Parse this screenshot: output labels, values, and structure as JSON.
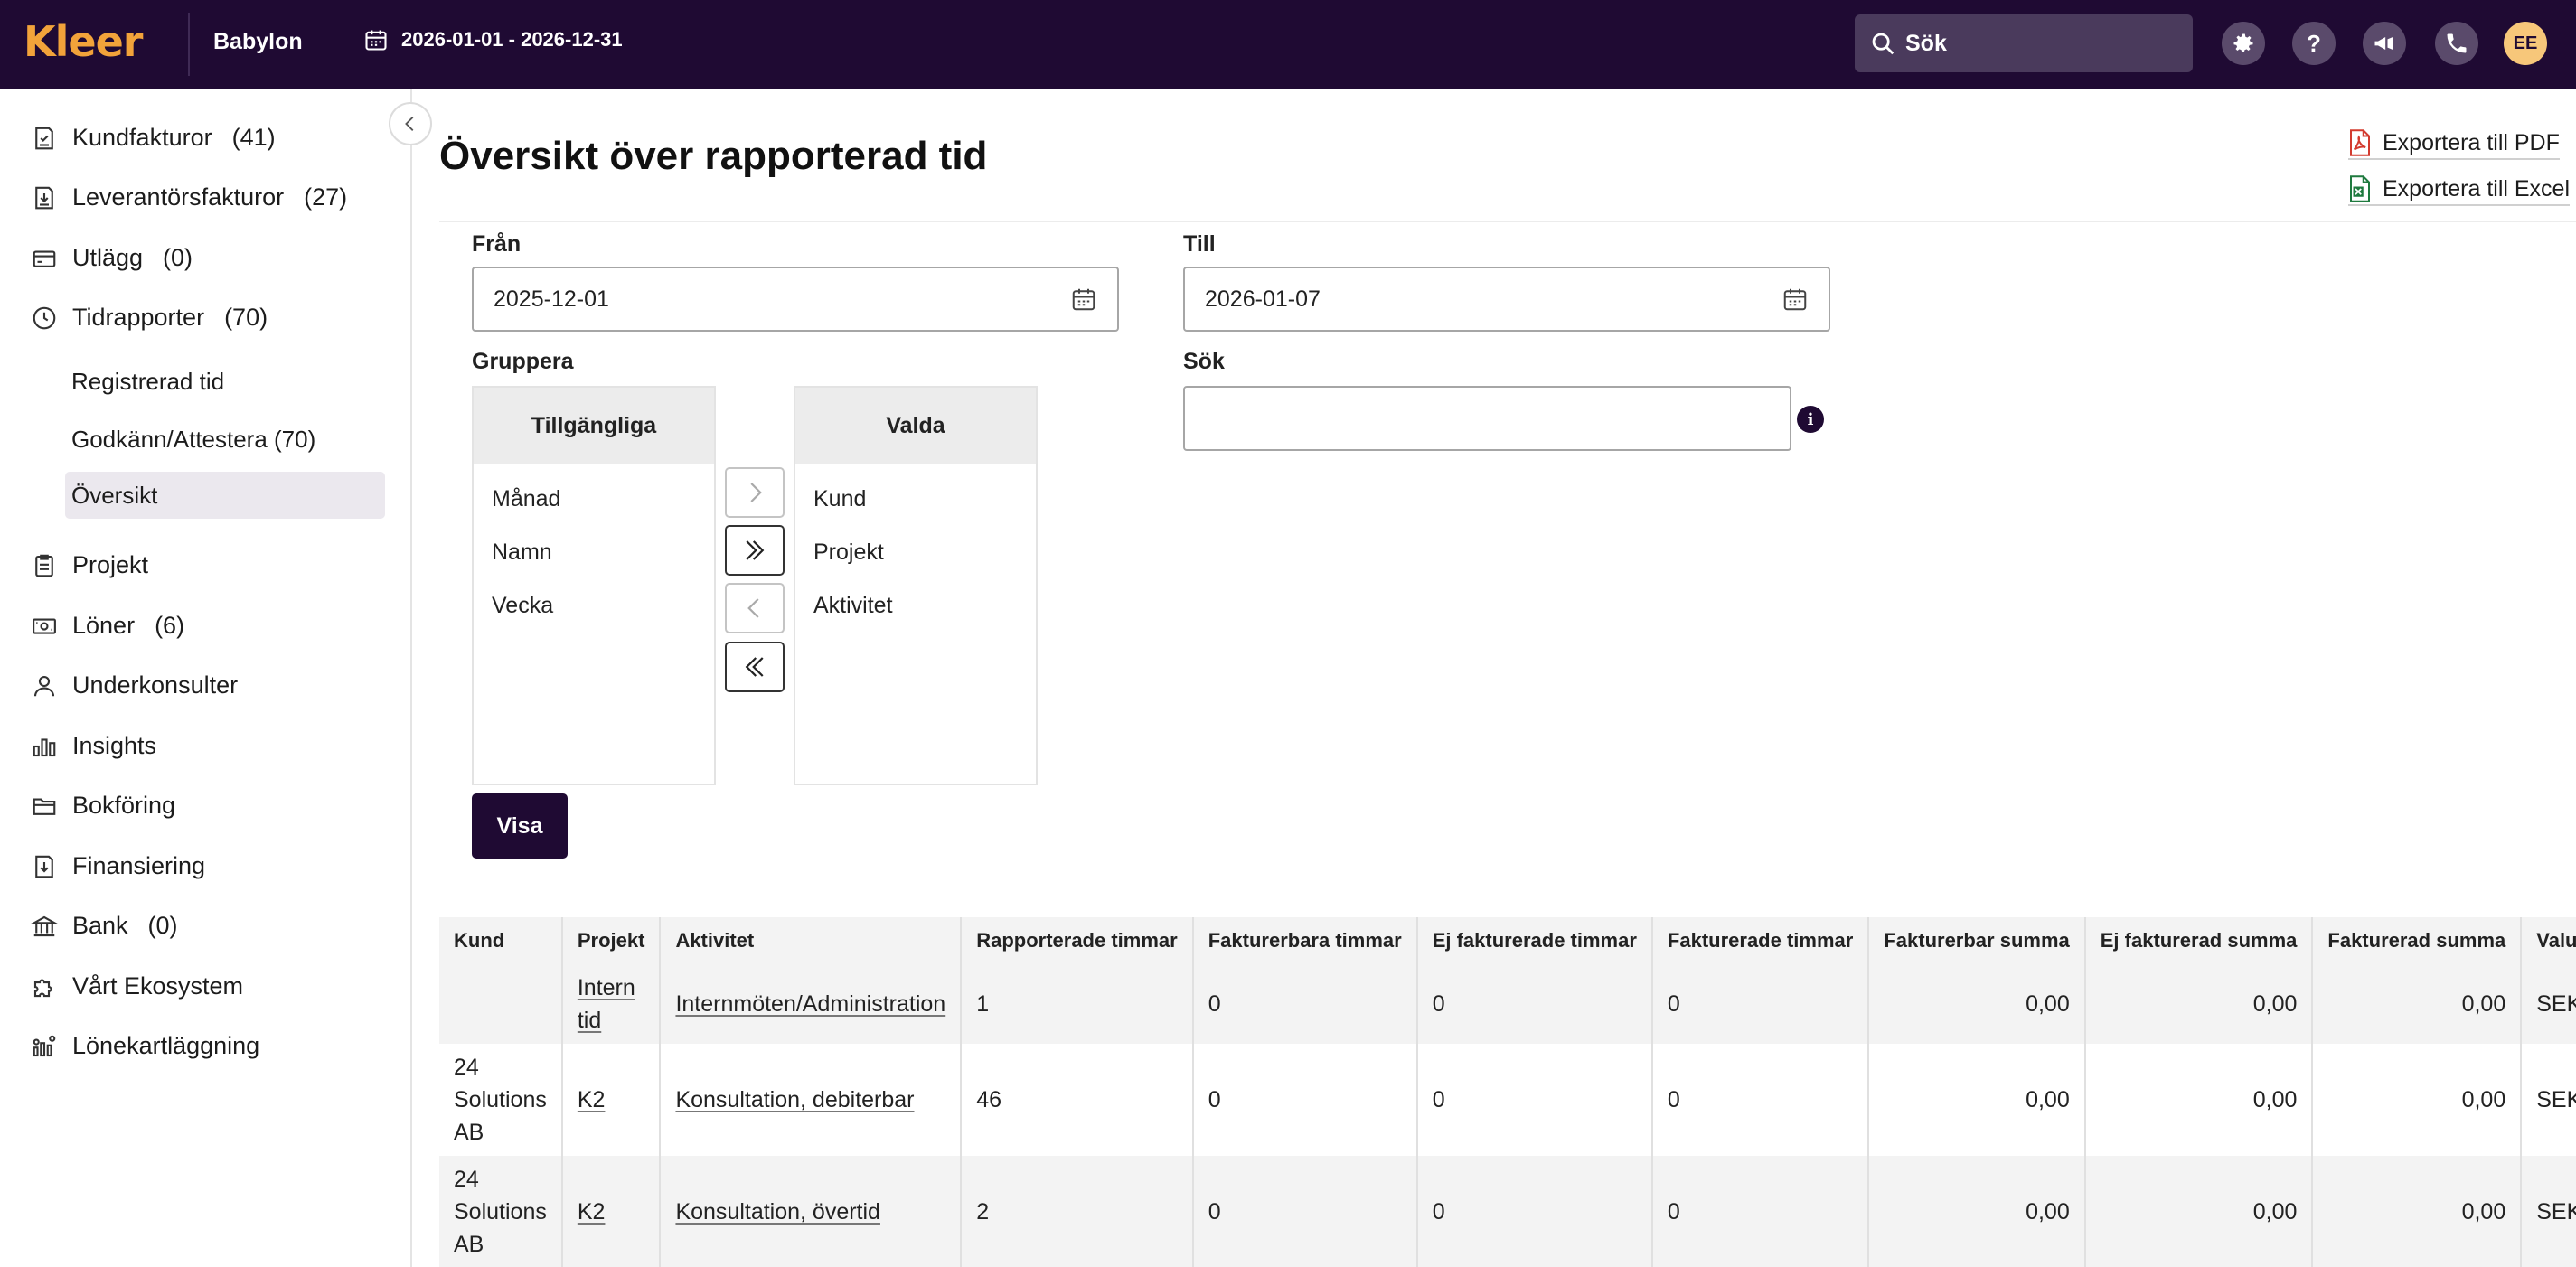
{
  "topbar": {
    "logo": "Kleer",
    "company": "Babylon",
    "period": "2026-01-01 - 2026-12-31",
    "search_placeholder": "Sök",
    "avatar_initials": "EE"
  },
  "sidebar": {
    "items": [
      {
        "label": "Kundfakturor",
        "count": "(41)",
        "icon": "invoice-icon"
      },
      {
        "label": "Leverantörsfakturor",
        "count": "(27)",
        "icon": "supplier-invoice-icon"
      },
      {
        "label": "Utlägg",
        "count": "(0)",
        "icon": "card-icon"
      },
      {
        "label": "Tidrapporter",
        "count": "(70)",
        "icon": "clock-icon"
      },
      {
        "label": "Projekt",
        "count": "",
        "icon": "clipboard-icon"
      },
      {
        "label": "Löner",
        "count": "(6)",
        "icon": "cash-icon"
      },
      {
        "label": "Underkonsulter",
        "count": "",
        "icon": "person-icon"
      },
      {
        "label": "Insights",
        "count": "",
        "icon": "bar-chart-icon"
      },
      {
        "label": "Bokföring",
        "count": "",
        "icon": "folder-icon"
      },
      {
        "label": "Finansiering",
        "count": "",
        "icon": "money-box-icon"
      },
      {
        "label": "Bank",
        "count": "(0)",
        "icon": "bank-icon"
      },
      {
        "label": "Vårt Ekosystem",
        "count": "",
        "icon": "puzzle-icon"
      },
      {
        "label": "Lönekartläggning",
        "count": "",
        "icon": "chart-people-icon"
      }
    ],
    "subitems": [
      {
        "label": "Registrerad tid",
        "active": false
      },
      {
        "label": "Godkänn/Attestera (70)",
        "active": false
      },
      {
        "label": "Översikt",
        "active": true
      }
    ]
  },
  "main": {
    "title": "Översikt över rapporterad tid",
    "export_pdf": "Exportera till PDF",
    "export_excel": "Exportera till Excel",
    "from_label": "Från",
    "from_value": "2025-12-01",
    "to_label": "Till",
    "to_value": "2026-01-07",
    "group_label": "Gruppera",
    "search_label": "Sök",
    "search_value": "",
    "available_header": "Tillgängliga",
    "available_items": [
      "Månad",
      "Namn",
      "Vecka"
    ],
    "selected_header": "Valda",
    "selected_items": [
      "Kund",
      "Projekt",
      "Aktivitet"
    ],
    "show_button": "Visa"
  },
  "table": {
    "columns": [
      "Kund",
      "Projekt",
      "Aktivitet",
      "Rapporterade timmar",
      "Fakturerbara timmar",
      "Ej fakturerade timmar",
      "Fakturerade timmar",
      "Fakturerbar summa",
      "Ej fakturerad summa",
      "Fakturerad summa",
      "Valuta"
    ],
    "rows": [
      [
        "",
        "Intern tid",
        "Internmöten/Administration",
        "1",
        "0",
        "0",
        "0",
        "0,00",
        "0,00",
        "0,00",
        "SEK"
      ],
      [
        "24 Solutions AB",
        "K2",
        "Konsultation, debiterbar",
        "46",
        "0",
        "0",
        "0",
        "0,00",
        "0,00",
        "0,00",
        "SEK"
      ],
      [
        "24 Solutions AB",
        "K2",
        "Konsultation, övertid",
        "2",
        "0",
        "0",
        "0",
        "0,00",
        "0,00",
        "0,00",
        "SEK"
      ],
      [
        "",
        "",
        "",
        "",
        "",
        "",
        "",
        "",
        "",
        "",
        ""
      ]
    ]
  },
  "colors": {
    "brand_dark": "#1f0a33",
    "logo_orange": "#f2a33a",
    "pdf_red": "#d33b2f",
    "excel_green": "#1f7a3f"
  }
}
